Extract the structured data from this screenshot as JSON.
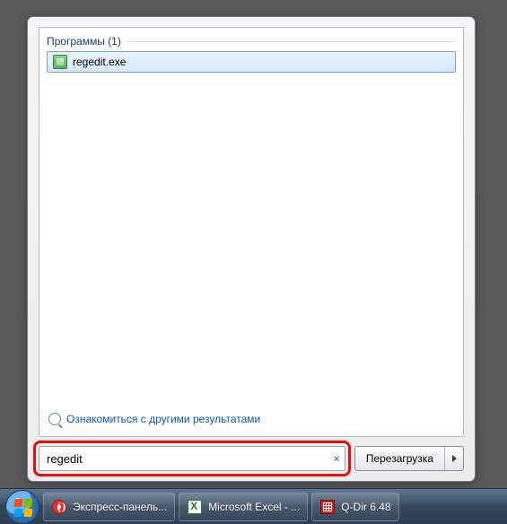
{
  "startmenu": {
    "group_header": "Программы (1)",
    "results": [
      {
        "label": "regedit.exe"
      }
    ],
    "more_results": "Ознакомиться с другими результатами",
    "search_value": "regedit",
    "search_placeholder": "",
    "shutdown_label": "Перезагрузка"
  },
  "taskbar": {
    "items": [
      {
        "label": "Экспресс-панель..."
      },
      {
        "label": "Microsoft Excel - ..."
      },
      {
        "label": "Q-Dir 6.48"
      }
    ]
  }
}
